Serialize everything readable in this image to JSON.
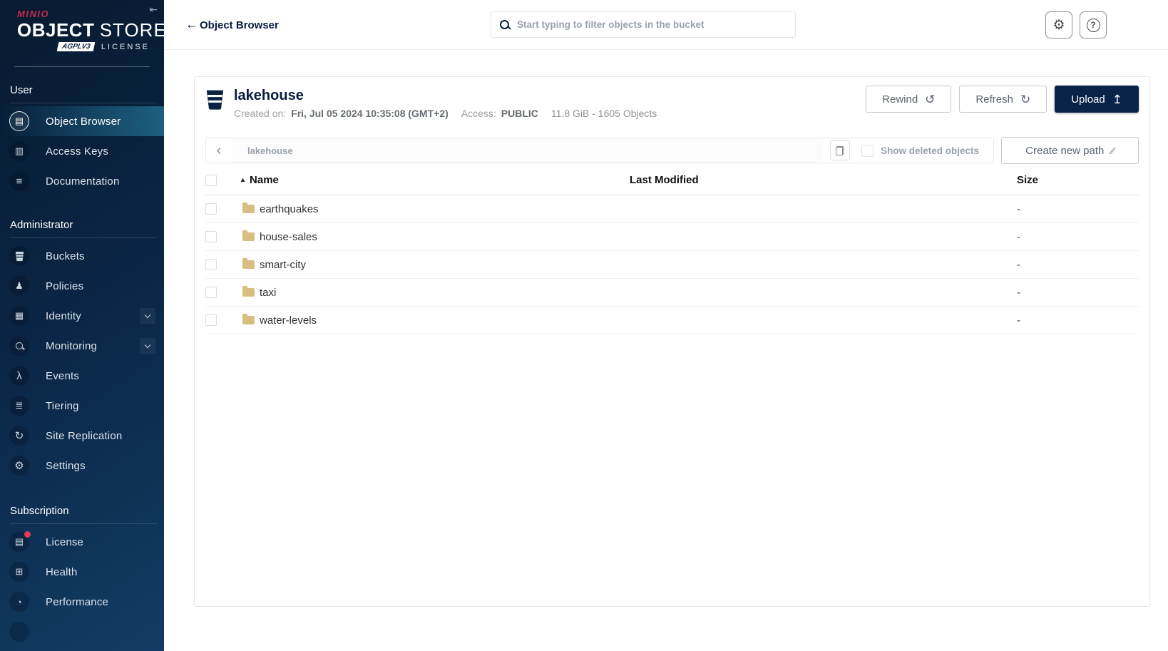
{
  "brand": {
    "minio": "MINIO",
    "object": "OBJECT",
    "store": "STORE",
    "badge": "AGPLV3",
    "license": "LICENSE"
  },
  "icons": {
    "collapse": "⇤",
    "back": "←",
    "gear": "⚙",
    "help": "?",
    "rewind": "↺",
    "refresh": "↻",
    "upload": "↥",
    "sort_asc": "▴",
    "chevron_left": "‹",
    "new_path": "∕∕",
    "object_browser": "▤",
    "access_keys": "▥",
    "documentation": "≡",
    "policies": "♟",
    "identity": "▦",
    "events": "λ",
    "tiering": "≣",
    "site_replication": "↻",
    "settings": "⚙",
    "license": "▤",
    "health": "⊞",
    "performance": "◔"
  },
  "sidebar": {
    "sections": [
      {
        "label": "User",
        "items": [
          {
            "label": "Object Browser"
          },
          {
            "label": "Access Keys"
          },
          {
            "label": "Documentation"
          }
        ]
      },
      {
        "label": "Administrator",
        "items": [
          {
            "label": "Buckets"
          },
          {
            "label": "Policies"
          },
          {
            "label": "Identity"
          },
          {
            "label": "Monitoring"
          },
          {
            "label": "Events"
          },
          {
            "label": "Tiering"
          },
          {
            "label": "Site Replication"
          },
          {
            "label": "Settings"
          }
        ]
      },
      {
        "label": "Subscription",
        "items": [
          {
            "label": "License"
          },
          {
            "label": "Health"
          },
          {
            "label": "Performance"
          }
        ]
      }
    ]
  },
  "header": {
    "title": "Object Browser",
    "search_placeholder": "Start typing to filter objects in the bucket"
  },
  "bucket": {
    "name": "lakehouse",
    "created_label": "Created on:",
    "created_value": "Fri, Jul 05 2024 10:35:08 (GMT+2)",
    "access_label": "Access:",
    "access_value": "PUBLIC",
    "stats": "11.8 GiB - 1605 Objects",
    "rewind_label": "Rewind",
    "refresh_label": "Refresh",
    "upload_label": "Upload"
  },
  "toolbar": {
    "path": "lakehouse",
    "show_deleted_label": "Show deleted objects",
    "create_path_label": "Create new path"
  },
  "table": {
    "headers": {
      "name": "Name",
      "modified": "Last Modified",
      "size": "Size"
    },
    "rows": [
      {
        "name": "earthquakes",
        "modified": "",
        "size": "-"
      },
      {
        "name": "house-sales",
        "modified": "",
        "size": "-"
      },
      {
        "name": "smart-city",
        "modified": "",
        "size": "-"
      },
      {
        "name": "taxi",
        "modified": "",
        "size": "-"
      },
      {
        "name": "water-levels",
        "modified": "",
        "size": "-"
      }
    ]
  },
  "colors": {
    "accent_red": "#C72C48",
    "navy": "#081C42",
    "active_teal": "#1d6080",
    "folder": "#d8bf80"
  }
}
